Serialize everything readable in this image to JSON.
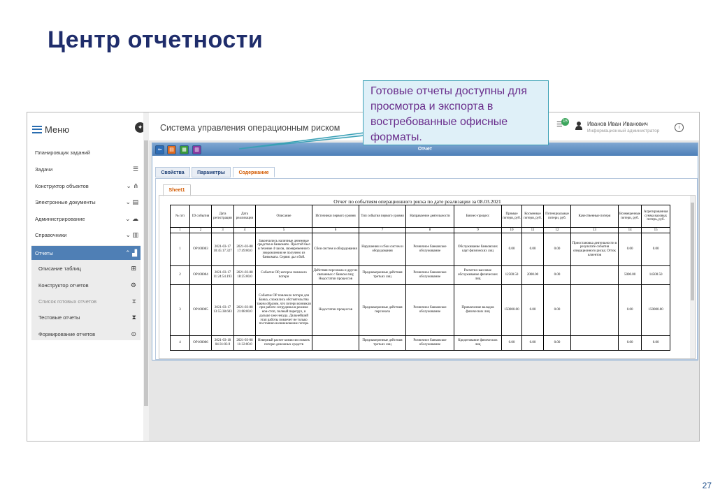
{
  "slide": {
    "title": "Центр отчетности",
    "page_number": "27"
  },
  "callout": {
    "text": "Готовые отчеты доступны для просмотра и экспорта в востребованные офисные форматы."
  },
  "sidebar": {
    "menu_label": "Меню",
    "items": [
      {
        "label": "Планировщик заданий"
      },
      {
        "label": "Задачи"
      },
      {
        "label": "Конструктор объектов"
      },
      {
        "label": "Электронные документы"
      },
      {
        "label": "Администрирование"
      },
      {
        "label": "Справочники"
      }
    ],
    "active_group": {
      "label": "Отчеты"
    },
    "sub_items": [
      {
        "label": "Описание таблиц"
      },
      {
        "label": "Конструктор отчетов"
      },
      {
        "label": "Список готовых отчетов"
      },
      {
        "label": "Тестовые отчеты"
      },
      {
        "label": "Формирование отчетов"
      }
    ]
  },
  "header": {
    "app_title": "Система управления операционным риском",
    "notification_count": "15",
    "user_name": "Иванов Иван Иванович",
    "user_role": "Информационный администратор"
  },
  "report_window": {
    "title": "Отчет",
    "tabs": [
      {
        "label": "Свойства"
      },
      {
        "label": "Параметры"
      },
      {
        "label": "Содержание"
      }
    ],
    "sheet_tab": "Sheet1",
    "report_title": "Отчет по событиям операционного риска по дате реализации за 08.03.2021",
    "columns": [
      "№ п/п",
      "ID события",
      "Дата регистрации",
      "Дата реализации",
      "Описание",
      "Источники первого уровня",
      "Тип события первого уровня",
      "Направление деятельности",
      "Бизнес-процесс",
      "Прямые потери, руб.",
      "Косвенные потери, руб.",
      "Потенциальные потери, руб.",
      "Качественные потери",
      "Возмещенные потери, руб.",
      "Агрегированная сумма валовых потерь, руб."
    ],
    "column_numbers": [
      "1",
      "2",
      "3",
      "4",
      "5",
      "6",
      "7",
      "8",
      "9",
      "10",
      "11",
      "12",
      "13",
      "14",
      "15"
    ],
    "rows": [
      {
        "cells": [
          "1",
          "OP100003",
          "2021-03-17 10:45:17.327",
          "2021-03-08 17:49:00.0",
          "Закончились наличные денежные средства в банкомате. Простой был в течение 4 часов, своевременного уведомления не получено из банкомата. Сервис дал сбой.",
          "Сбои систем и оборудования",
          "Нарушения и сбои систем и оборудования",
          "Розничное банковское обслуживание",
          "Обслуживание банковских карт физических лиц",
          "0.00",
          "0.00",
          "0.00",
          "Приостановка деятельности в результате события операционного риска; Отток клиентов",
          "0.00",
          "0.00"
        ]
      },
      {
        "cells": [
          "2",
          "OP100004",
          "2021-03-17 11:24:54.193",
          "2021-03-08 18:25:00.0",
          "Событие ОР, которое повлекло потери",
          "Действия персонала и других связанных с банком лиц; Недостатки процессов",
          "Преднамеренные действия третьих лиц",
          "Розничное банковское обслуживание",
          "Расчетно-кассовое обслуживание физических лиц",
          "12500.50",
          "2000.00",
          "0.00",
          "",
          "5000.00",
          "14500.50"
        ]
      },
      {
        "cells": [
          "3",
          "OP100005",
          "2021-03-17 13:55:38.603",
          "2021-03-08 21:08:00.0",
          "Событие ОР повлекло потери для Банка, сложились обстоятельства таким образом, что потери возникли при работе сотрудника в режиме нон-стоп, полный перегруз, и дальше уже некуда. Дальнейший этап работы повлечет не только постоянно возникновение потерь",
          "Недостатки процессов",
          "Преднамеренные действия персонала",
          "Розничное банковское обслуживание",
          "Привлечение вкладов физических лиц",
          "150000.00",
          "0.00",
          "0.00",
          "",
          "0.00",
          "150000.00"
        ]
      },
      {
        "cells": [
          "4",
          "OP100006",
          "2021-03-18 04:31:03.9",
          "2021-03-08 11:32:00.0",
          "Неверный расчет комиссии повлек потерю денежных средств",
          "",
          "Преднамеренные действия третьих лиц",
          "Розничное банковское обслуживание",
          "Кредитование физических лиц",
          "0.00",
          "0.00",
          "0.00",
          "",
          "0.00",
          "0.00"
        ]
      }
    ]
  }
}
